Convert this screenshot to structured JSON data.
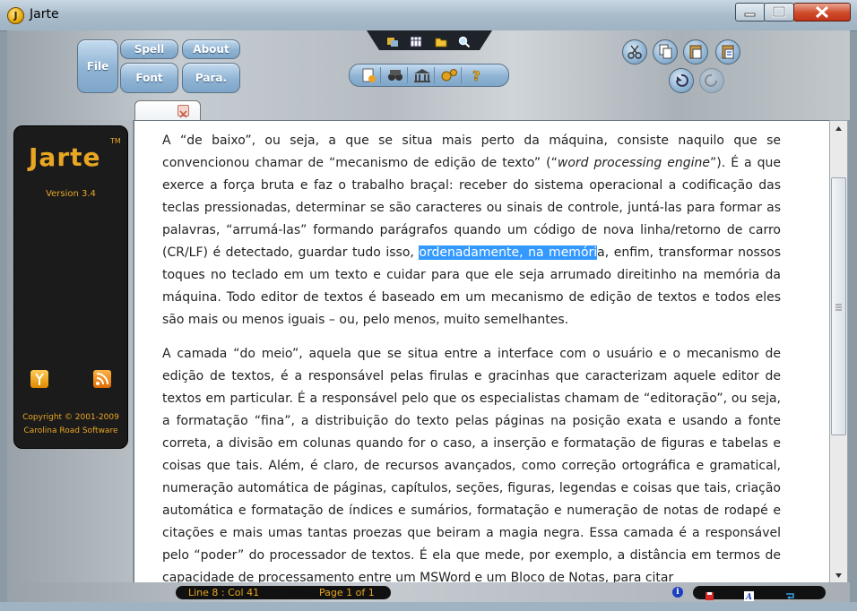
{
  "window": {
    "title": "Jarte",
    "app_icon_letter": "J"
  },
  "toolbar": {
    "file": "File",
    "spell": "Spell",
    "about": "About",
    "font": "Font",
    "para": "Para."
  },
  "panel": {
    "logo": "Jarte",
    "tm": "TM",
    "version": "Version 3.4",
    "copyright_line1": "Copyright © 2001-2009",
    "copyright_line2": "Carolina Road Software"
  },
  "document": {
    "p1_before": "A “de baixo”, ou seja, a que se situa mais perto da máquina, consiste naquilo que se convencionou chamar de “mecanismo de edição de texto” (“",
    "p1_italic": "word processing engine",
    "p1_mid": "”). É a que exerce a força bruta e faz o trabalho braçal: receber do sistema operacional a codificação das teclas pressionadas, determinar se são caracteres ou sinais de controle, juntá-las para formar as palavras, “arrumá-las” formando parágrafos quando um código de nova linha/retorno de carro (CR/LF) é detectado, guardar tudo isso, ",
    "p1_selected": "ordenadamente, na memóri",
    "p1_after": "a, enfim, transformar nossos toques no teclado em um texto e cuidar para que ele seja arrumado direitinho na memória da máquina. Todo editor de textos é baseado em um mecanismo de edição de textos e todos eles são mais ou menos iguais – ou, pelo menos, muito semelhantes.",
    "p2": "A camada “do meio”, aquela que se situa entre a interface com o usuário e o mecanismo de edição de textos, é a responsável pelas firulas e gracinhas que caracterizam aquele editor de textos em particular. É a responsável pelo que os especialistas chamam de “editoração”, ou seja, a formatação “fina”, a distribuição do texto pelas páginas na posição exata e usando a fonte correta, a divisão em colunas quando for o caso, a inserção e formatação de figuras e tabelas e coisas que tais. Além, é claro, de recursos avançados, como correção ortográfica e gramatical, numeração automática de páginas, capítulos, seções, figuras, legendas e coisas que tais, criação automática e formatação de índices e sumários, formatação e numeração de notas de rodapé e citações e mais umas tantas proezas que beiram a magia negra. Essa camada é a responsável pelo “poder” do processador de textos. É ela que mede, por exemplo, a distância em termos de capacidade de processamento entre um MSWord e um Bloco de Notas, para citar"
  },
  "status": {
    "position": "Line 8 : Col 41",
    "page": "Page 1 of 1",
    "info_letter": "i"
  },
  "colors": {
    "accent_orange": "#e8a623",
    "button_blue": "#8fb3d3",
    "selection": "#3399ff"
  }
}
